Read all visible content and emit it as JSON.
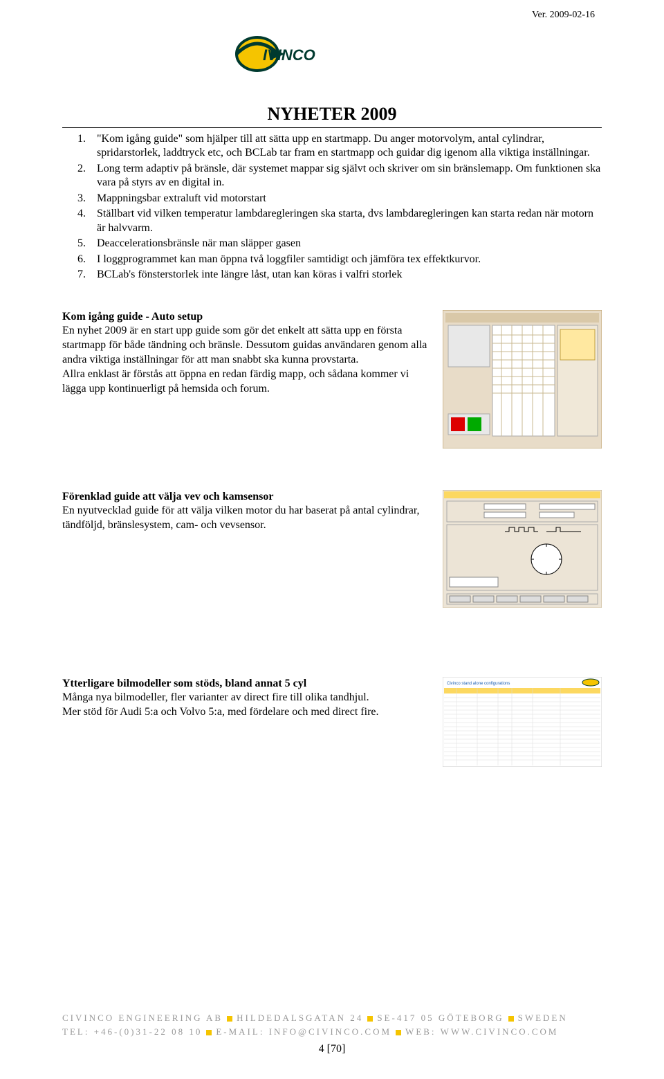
{
  "version": "Ver. 2009-02-16",
  "logo_text": "CIVINCO",
  "title": "NYHETER 2009",
  "list": [
    "\"Kom igång guide\" som hjälper till att sätta upp en startmapp. Du anger motorvolym, antal cylindrar, spridarstorlek, laddtryck etc, och BCLab tar fram en startmapp och guidar dig igenom alla viktiga inställningar.",
    "Long term adaptiv på bränsle, där systemet mappar sig självt och skriver om sin bränslemapp. Om funktionen ska vara på styrs av en digital in.",
    "Mappningsbar extraluft vid motorstart",
    "Ställbart vid vilken temperatur lambdaregleringen ska starta, dvs lambdaregleringen kan starta redan när motorn är halvvarm.",
    "Deaccelerationsbränsle när man släpper gasen",
    "I loggprogrammet kan man öppna två loggfiler samtidigt och jämföra tex effektkurvor.",
    "BCLab's fönsterstorlek inte längre låst, utan kan köras i valfri storlek"
  ],
  "sections": [
    {
      "heading": "Kom igång guide - Auto setup",
      "body": "En nyhet 2009 är en start upp guide som gör det enkelt att sätta upp en första startmapp för både tändning och bränsle. Dessutom guidas användaren genom alla andra viktiga inställningar för att man snabbt ska kunna provstarta.\nAllra enklast är förstås att öppna en redan färdig mapp, och sådana kommer vi lägga upp kontinuerligt på hemsida och forum."
    },
    {
      "heading": "Förenklad guide att välja vev och kamsensor",
      "body": "En nyutvecklad guide för att välja vilken motor du har baserat på antal cylindrar, tändföljd, bränslesystem, cam- och vevsensor."
    },
    {
      "heading": "Ytterligare bilmodeller som stöds, bland annat 5 cyl",
      "body": "Många nya bilmodeller, fler varianter av direct fire till olika tandhjul.\nMer stöd för Audi 5:a och Volvo 5:a, med fördelare och med direct fire."
    }
  ],
  "footer": {
    "company": "CIVINCO ENGINEERING AB",
    "address": "HILDEDALSGATAN 24",
    "postal": "SE-417 05 GÖTEBORG",
    "country": "SWEDEN",
    "tel_label": "TEL:",
    "tel": "+46-(0)31-22 08 10",
    "email_label": "E-MAIL:",
    "email": "INFO@CIVINCO.COM",
    "web_label": "WEB:",
    "web": "WWW.CIVINCO.COM",
    "pagenum": "4 [70]"
  }
}
